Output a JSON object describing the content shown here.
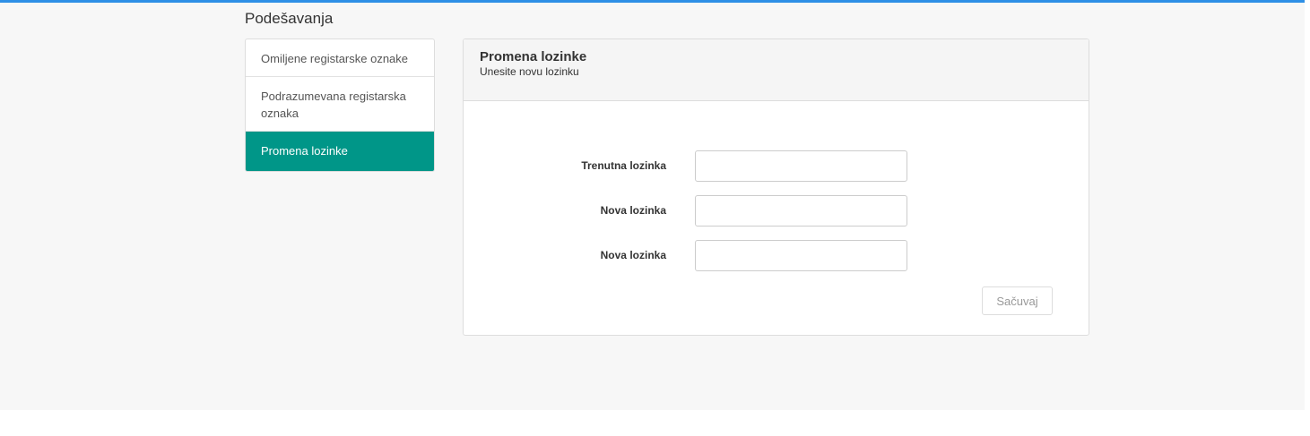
{
  "page": {
    "title": "Podešavanja"
  },
  "sidebar": {
    "items": [
      {
        "label": "Omiljene registarske oznake",
        "active": false
      },
      {
        "label": "Podrazumevana registarska oznaka",
        "active": false
      },
      {
        "label": "Promena lozinke",
        "active": true
      }
    ]
  },
  "panel": {
    "title": "Promena lozinke",
    "subtitle": "Unesite novu lozinku"
  },
  "form": {
    "fields": [
      {
        "label": "Trenutna lozinka",
        "value": "",
        "type": "password"
      },
      {
        "label": "Nova lozinka",
        "value": "",
        "type": "password"
      },
      {
        "label": "Nova lozinka",
        "value": "",
        "type": "password"
      }
    ],
    "save_label": "Sačuvaj"
  },
  "colors": {
    "accent_top_bar": "#2e8fe6",
    "active_nav": "#009688"
  }
}
